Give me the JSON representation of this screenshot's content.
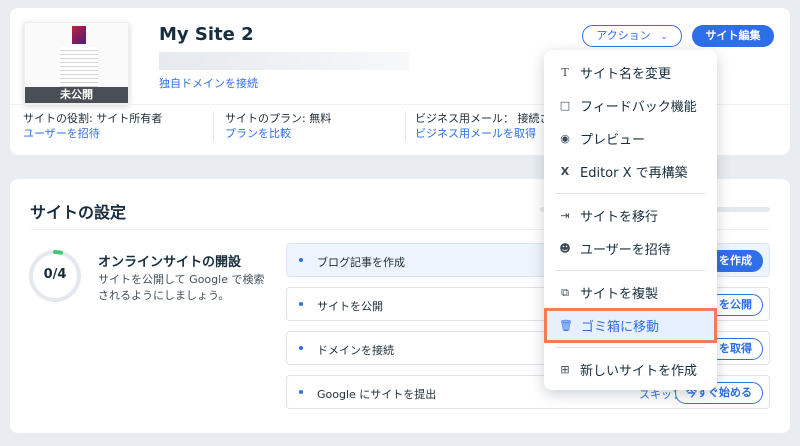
{
  "site": {
    "title": "My Site 2",
    "status": "未公開",
    "connect_domain": "独自ドメインを接続",
    "role_label": "サイトの役割: サイト所有者",
    "invite_link": "ユーザーを招待",
    "plan_label": "サイトのプラン: 無料",
    "compare_plans": "プランを比較",
    "email_label": "ビジネス用メール： 接続さ",
    "get_email": "ビジネス用メールを取得"
  },
  "header": {
    "action_label": "アクション",
    "edit_label": "サイト編集"
  },
  "menu": {
    "items": [
      {
        "label": "サイト名を変更",
        "icon": "text-icon"
      },
      {
        "label": "フィードバック機能",
        "icon": "comment-icon"
      },
      {
        "label": "プレビュー",
        "icon": "eye-icon"
      },
      {
        "label": "Editor X で再構築",
        "icon": "editor-x-icon"
      },
      {
        "label": "サイトを移行",
        "icon": "transfer-icon"
      },
      {
        "label": "ユーザーを招待",
        "icon": "add-user-icon"
      },
      {
        "label": "サイトを複製",
        "icon": "duplicate-icon"
      },
      {
        "label": "ゴミ箱に移動",
        "icon": "trash-icon"
      },
      {
        "label": "新しいサイトを作成",
        "icon": "new-site-icon"
      }
    ]
  },
  "settings": {
    "title": "サイトの設定",
    "progress": "0/4",
    "progress_fraction": 0.04,
    "goal_title": "オンラインサイトの開設",
    "goal_desc": "サイトを公開して Google で検索されるようにしましょう。",
    "tasks": [
      {
        "label": "ブログ記事を作成",
        "button": "を作成"
      },
      {
        "label": "サイトを公開",
        "button": "を公開"
      },
      {
        "label": "ドメインを接続",
        "button": "を取得"
      },
      {
        "label": "Google にサイトを提出",
        "button": "今すぐ始める",
        "skip": "スキップ"
      }
    ]
  },
  "colors": {
    "accent": "#2f6ee9",
    "highlight": "#f27b5b",
    "background": "#e9edf2"
  }
}
